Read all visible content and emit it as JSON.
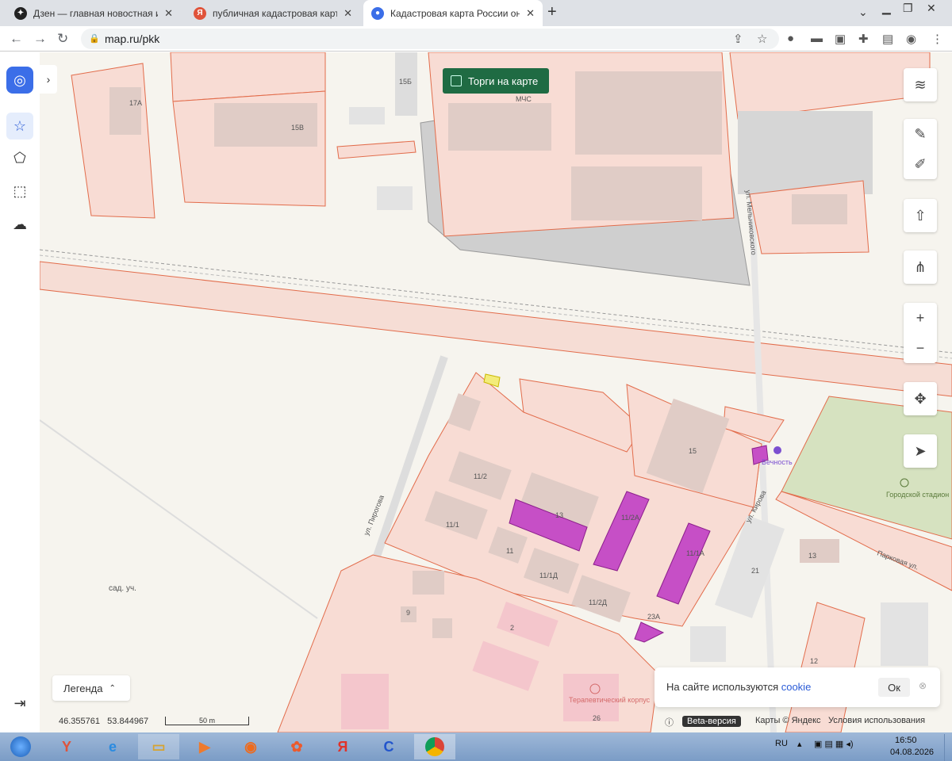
{
  "tabs": [
    {
      "title": "Дзен — главная новостная инф",
      "favicon": "dzen-icon",
      "color": "#222"
    },
    {
      "title": "публичная кадастровая карта –",
      "favicon": "yandex-icon",
      "color": "#e0533a"
    },
    {
      "title": "Кадастровая карта России онла",
      "favicon": "mapru-icon",
      "color": "#3b6ee8"
    }
  ],
  "address": {
    "url": "map.ru/pkk"
  },
  "torgi": {
    "label": "Торги на карте"
  },
  "legend": {
    "label": "Легенда"
  },
  "coords": {
    "lat": "46.355761",
    "lon": "53.844967"
  },
  "scale": {
    "label": "50 m"
  },
  "cookie": {
    "text": "На сайте используются ",
    "link": "cookie",
    "ok": "Ок"
  },
  "attribution": {
    "beta": "Beta-версия",
    "maps": "Карты © Яндекс",
    "terms": "Условия использования"
  },
  "map_labels": {
    "l17a": "17А",
    "l15b": "15Б",
    "l15v": "15В",
    "mchs": "МЧС",
    "street_pirogova": "ул. Пирогова",
    "street_kirova": "ул. Кирова",
    "street_park": "Парковая ул.",
    "street_mel": "ул. Мельниковского",
    "sad": "сад. уч.",
    "b15": "15",
    "b11_2": "11/2",
    "b11_1": "11/1",
    "b13": "13",
    "b11_2a": "11/2А",
    "b11": "11",
    "b11_1d": "11/1Д",
    "b11_2d": "11/2Д",
    "b11_1a": "11/1А",
    "b23a": "23А",
    "b9": "9",
    "b2": "2",
    "b26": "26",
    "b21": "21",
    "b13b": "13",
    "b12": "12",
    "vechnost": "Вечность",
    "stadium": "Городской стадион",
    "korpus": "Терапевтический корпус"
  },
  "tray": {
    "lang": "RU",
    "time": "16:50",
    "date": "04.08.2026"
  }
}
